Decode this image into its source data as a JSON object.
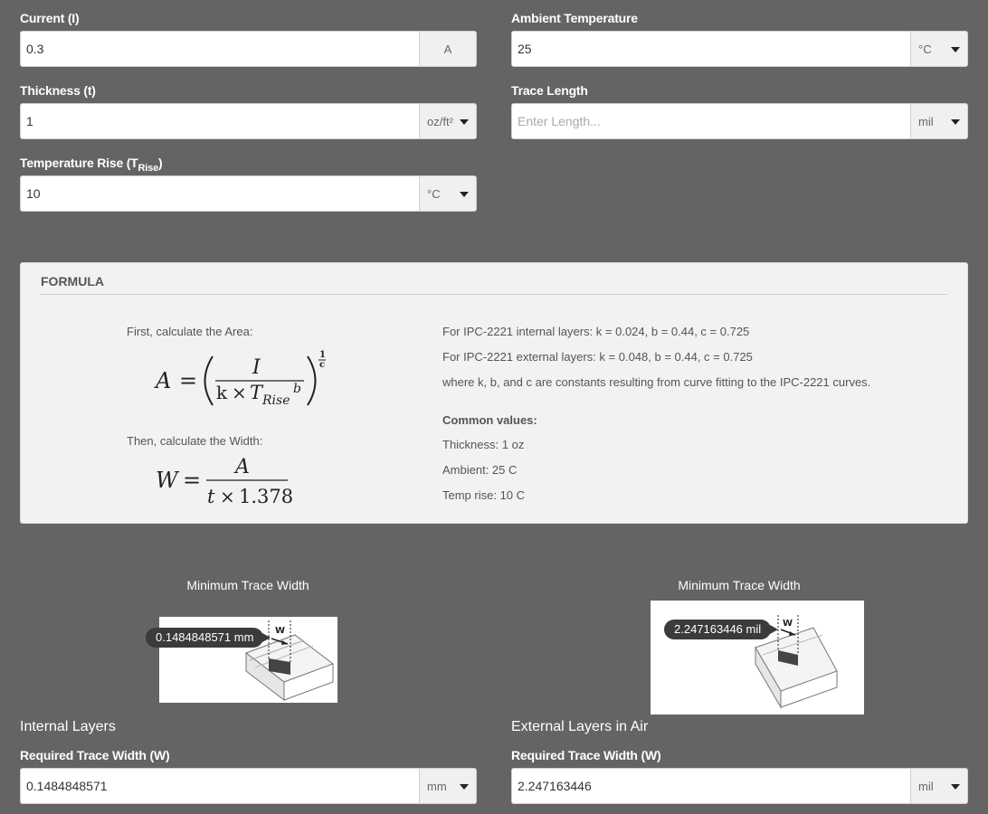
{
  "inputs": {
    "current": {
      "label": "Current (I)",
      "value": "0.3",
      "unit": "A"
    },
    "thickness": {
      "label": "Thickness (t)",
      "value": "1",
      "unit": "oz/ft²"
    },
    "temp_rise": {
      "label_main": "Temperature Rise (T",
      "label_sub": "Rise",
      "label_end": ")",
      "value": "10",
      "unit": "°C"
    },
    "ambient": {
      "label": "Ambient Temperature",
      "value": "25",
      "unit": "°C"
    },
    "trace_length": {
      "label": "Trace Length",
      "value": "",
      "placeholder": "Enter Length...",
      "unit": "mil"
    }
  },
  "formula": {
    "title": "FORMULA",
    "step1": "First, calculate the Area:",
    "step2": "Then, calculate the Width:",
    "internal": "For IPC-2221 internal layers: k = 0.024, b = 0.44, c = 0.725",
    "external": "For IPC-2221 external layers: k = 0.048, b = 0.44, c = 0.725",
    "note": "where k, b, and c are constants resulting from curve fitting to the IPC-2221 curves.",
    "common_title": "Common values:",
    "common_values": [
      "Thickness: 1 oz",
      "Ambient: 25 C",
      "Temp rise: 10 C"
    ]
  },
  "results": {
    "internal": {
      "diagram_label": "Minimum Trace Width",
      "badge": "0.1484848571 mm",
      "section": "Internal Layers",
      "label": "Required Trace Width (W)",
      "value": "0.1484848571",
      "unit": "mm"
    },
    "external": {
      "diagram_label": "Minimum Trace Width",
      "badge": "2.247163446 mil",
      "section": "External Layers in Air",
      "label": "Required Trace Width (W)",
      "value": "2.247163446",
      "unit": "mil"
    }
  },
  "diagram_marker": "W"
}
